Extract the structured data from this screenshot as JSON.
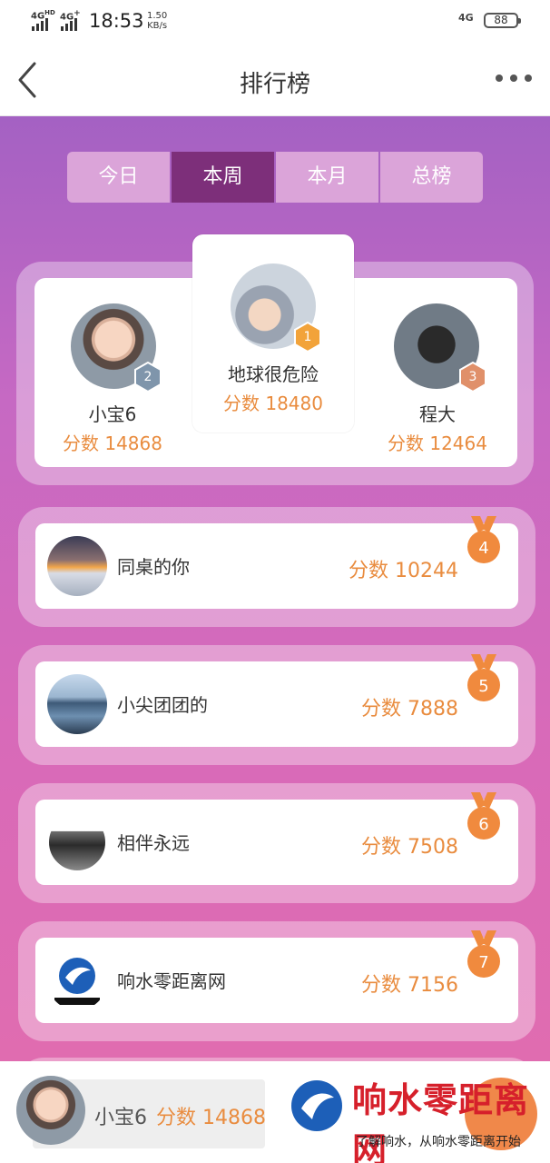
{
  "status_bar": {
    "sig1": "4G",
    "sig1_sup": "HD",
    "sig2": "4G",
    "sig2_sup": "+",
    "time": "18:53",
    "speed_value": "1.50",
    "speed_unit": "KB/s",
    "right_network": "4G",
    "battery": "88"
  },
  "nav": {
    "title": "排行榜",
    "back_icon": "chevron-left-icon",
    "more_icon": "more-dots-icon"
  },
  "tabs": [
    {
      "label": "今日",
      "active": false
    },
    {
      "label": "本周",
      "active": true
    },
    {
      "label": "本月",
      "active": false
    },
    {
      "label": "总榜",
      "active": false
    }
  ],
  "podium": {
    "first": {
      "rank": "1",
      "name": "地球很危险",
      "score": "分数 18480"
    },
    "second": {
      "rank": "2",
      "name": "小宝6",
      "score": "分数 14868"
    },
    "third": {
      "rank": "3",
      "name": "程大",
      "score": "分数 12464"
    }
  },
  "list": [
    {
      "rank": "4",
      "name": "同桌的你",
      "score": "分数 10244"
    },
    {
      "rank": "5",
      "name": "小尖团团的",
      "score": "分数 7888"
    },
    {
      "rank": "6",
      "name": "相伴永远",
      "score": "分数 7508"
    },
    {
      "rank": "7",
      "name": "响水零距离网",
      "score": "分数 7156"
    }
  ],
  "my_rank": {
    "name": "小宝6",
    "score": "分数 14868"
  },
  "watermark": {
    "title": "响水零距离网",
    "subtitle": "了解响水，从响水零距离开始"
  },
  "colors": {
    "accent": "#e98c3f",
    "tab_active": "#7d2f7a",
    "bg_top": "#a461c3",
    "bg_bottom": "#e06cb0"
  }
}
